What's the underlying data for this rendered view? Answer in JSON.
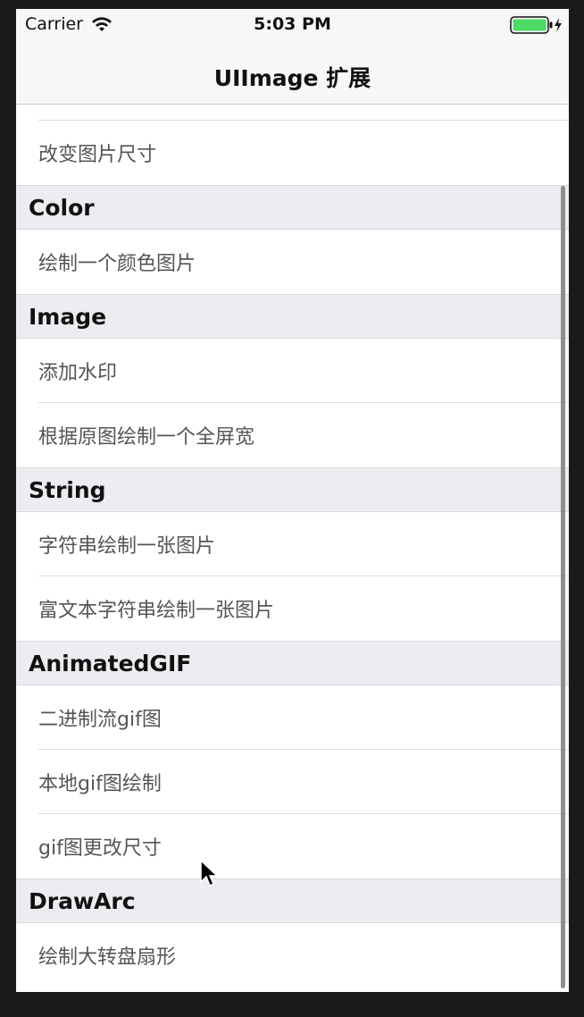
{
  "status_bar": {
    "carrier": "Carrier",
    "time": "5:03 PM",
    "battery_color": "#4cd964"
  },
  "nav": {
    "title": "UIImage 扩展"
  },
  "list": {
    "top_partial_row": "改变图片尺寸",
    "sections": [
      {
        "header": "Color",
        "rows": [
          "绘制一个颜色图片"
        ]
      },
      {
        "header": "Image",
        "rows": [
          "添加水印",
          "根据原图绘制一个全屏宽"
        ]
      },
      {
        "header": "String",
        "rows": [
          "字符串绘制一张图片",
          "富文本字符串绘制一张图片"
        ]
      },
      {
        "header": "AnimatedGIF",
        "rows": [
          "二进制流gif图",
          "本地gif图绘制",
          "gif图更改尺寸"
        ]
      },
      {
        "header": "DrawArc",
        "rows": [
          "绘制大转盘扇形"
        ]
      }
    ]
  },
  "icons": {
    "wifi": "wifi-icon",
    "battery": "battery-icon",
    "charging": "bolt-icon",
    "cursor": "mouse-pointer-icon"
  }
}
